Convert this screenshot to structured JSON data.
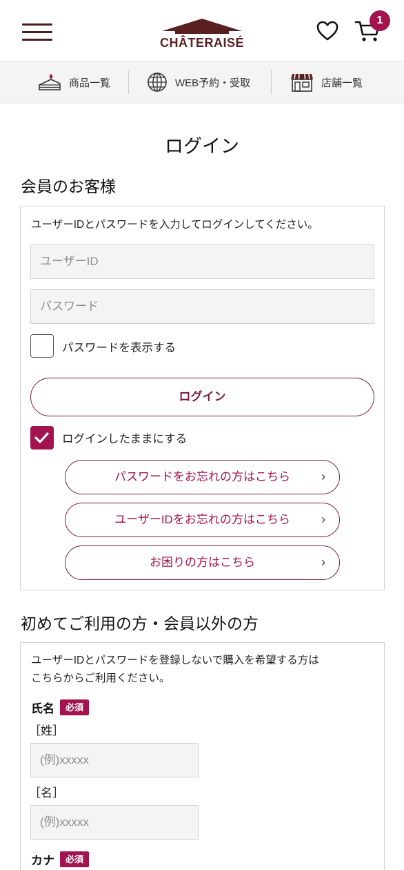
{
  "header": {
    "logo_text": "CHÂTERAISÉ",
    "cart_count": "1",
    "colors": {
      "brand": "#5a1f1f",
      "accent": "#a3134d"
    }
  },
  "nav": {
    "items": [
      {
        "label": "商品一覧",
        "icon": "cake-icon"
      },
      {
        "label": "WEB予約・受取",
        "icon": "globe-icon"
      },
      {
        "label": "店舗一覧",
        "icon": "store-icon"
      }
    ]
  },
  "page": {
    "title": "ログイン"
  },
  "member": {
    "title": "会員のお客様",
    "instruction": "ユーザーIDとパスワードを入力してログインしてください。",
    "userid_placeholder": "ユーザーID",
    "password_placeholder": "パスワード",
    "show_password_label": "パスワードを表示する",
    "show_password_checked": false,
    "login_button": "ログイン",
    "keep_login_label": "ログインしたままにする",
    "keep_login_checked": true,
    "links": [
      "パスワードをお忘れの方はこちら",
      "ユーザーIDをお忘れの方はこちら",
      "お困りの方はこちら"
    ]
  },
  "guest": {
    "title": "初めてご利用の方・会員以外の方",
    "instruction_line1": "ユーザーIDとパスワードを登録しないで購入を希望する方は",
    "instruction_line2": "こちらからご利用ください。",
    "name_label": "氏名",
    "required_badge": "必須",
    "last_name_label": "［姓］",
    "first_name_label": "［名］",
    "name_placeholder": "(例)xxxxx",
    "kana_label": "カナ"
  }
}
